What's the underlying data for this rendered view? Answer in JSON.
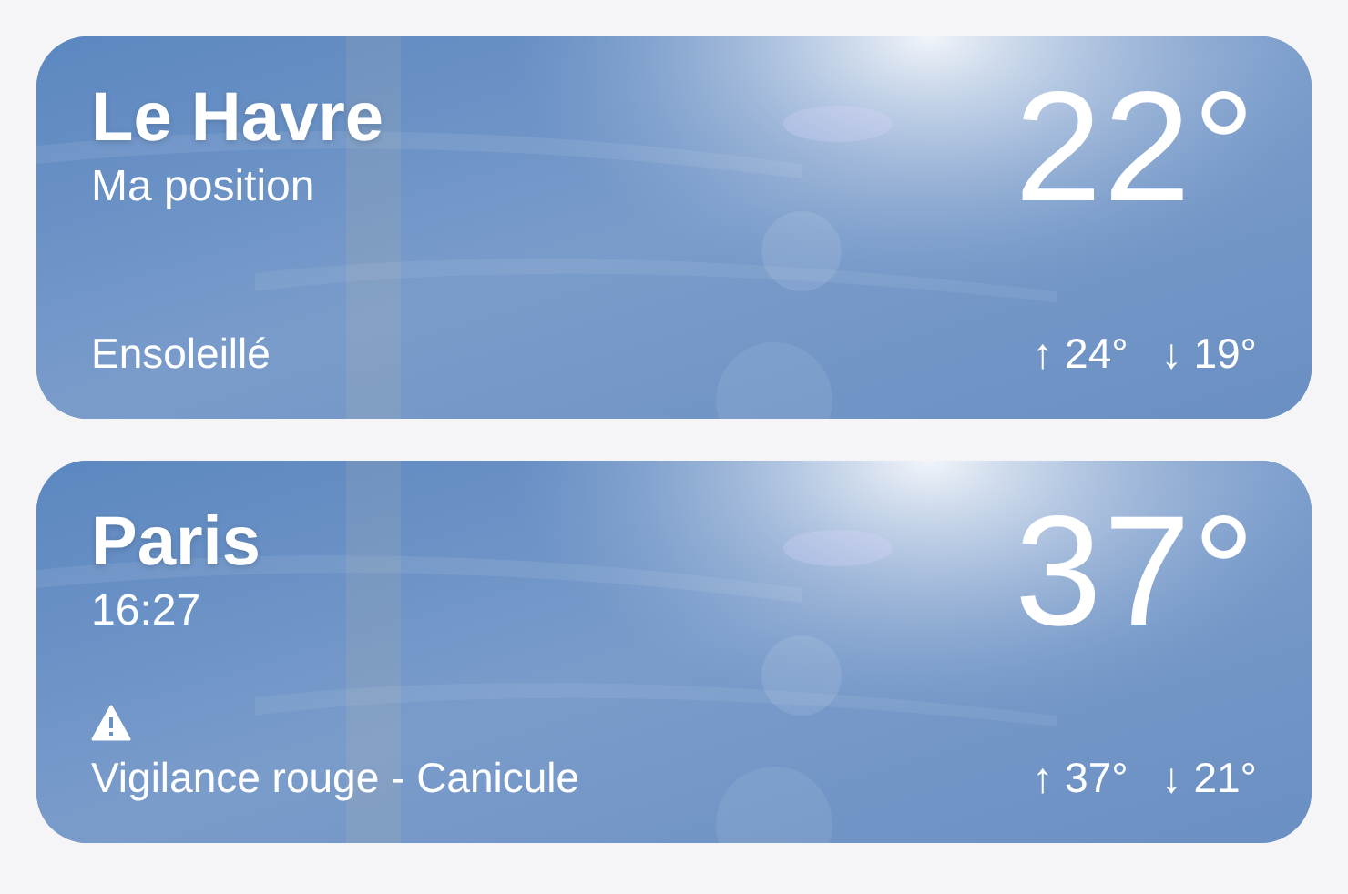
{
  "locations": [
    {
      "city": "Le Havre",
      "subtitle": "Ma position",
      "temperature": "22°",
      "alert": false,
      "condition": "Ensoleillé",
      "high": "↑ 24°",
      "low": "↓ 19°"
    },
    {
      "city": "Paris",
      "subtitle": "16:27",
      "temperature": "37°",
      "alert": true,
      "condition": "Vigilance rouge - Canicule",
      "high": "↑ 37°",
      "low": "↓ 21°"
    }
  ]
}
